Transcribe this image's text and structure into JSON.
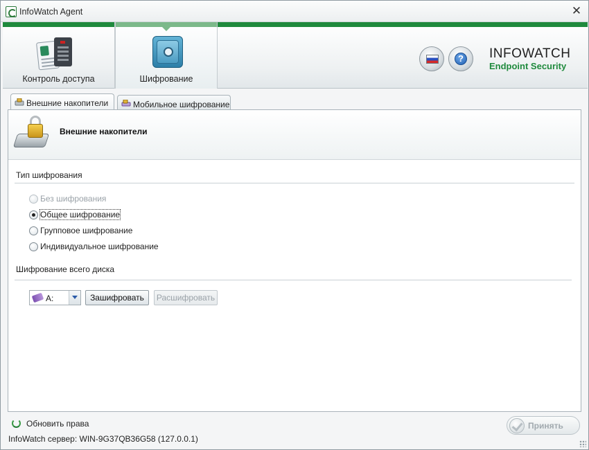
{
  "window": {
    "title": "InfoWatch Agent"
  },
  "header": {
    "nav": [
      {
        "label": "Контроль доступа",
        "icon": "access-control-icon"
      },
      {
        "label": "Шифрование",
        "icon": "safe-icon"
      }
    ],
    "brand": {
      "line1": "INFOWATCH",
      "line2": "Endpoint Security"
    },
    "colors": {
      "brand_green": "#1f8a3d",
      "active_tab": "#7cb98a"
    }
  },
  "tabs": [
    {
      "label": "Внешние накопители",
      "active": true
    },
    {
      "label": "Мобильное шифрование",
      "active": false
    }
  ],
  "panel": {
    "title": "Внешние накопители",
    "encryption_type": {
      "title": "Тип шифрования",
      "options": [
        {
          "label": "Без шифрования",
          "enabled": false,
          "checked": false
        },
        {
          "label": "Общее шифрование",
          "enabled": true,
          "checked": true
        },
        {
          "label": "Групповое шифрование",
          "enabled": true,
          "checked": false
        },
        {
          "label": "Индивидуальное шифрование",
          "enabled": true,
          "checked": false
        }
      ]
    },
    "disk_encryption": {
      "title": "Шифрование всего диска",
      "drive": "A:",
      "encrypt_label": "Зашифровать",
      "decrypt_label": "Расшифровать"
    }
  },
  "footer": {
    "refresh_label": "Обновить права",
    "server_text": "InfoWatch сервер: WIN-9G37QB36G58 (127.0.0.1)",
    "accept_label": "Принять"
  }
}
